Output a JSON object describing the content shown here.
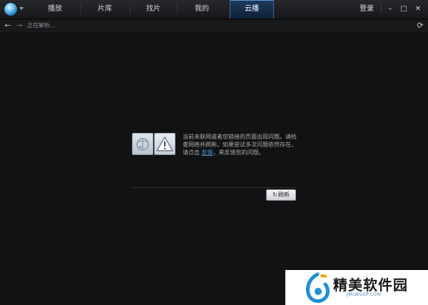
{
  "titlebar": {
    "tabs": [
      "播放",
      "片库",
      "找片",
      "我的",
      "云播"
    ],
    "active_tab": "云播",
    "login": "登录",
    "minimize": "–",
    "maximize": "□",
    "close": "✕"
  },
  "navbar": {
    "back": "←",
    "forward": "→",
    "status": "正在解析...",
    "refresh": "⟳"
  },
  "error": {
    "message_part1": "当前未联网或者您链接的页面出现问题。请检查网络并刷新。如果尝试多次问题依然存在，请点击 ",
    "link_text": "反馈",
    "message_part2": "，来反馈您的问题。",
    "refresh_button": "刷新",
    "refresh_icon": "↻"
  },
  "watermark": {
    "title": "精美软件园",
    "subtitle": "JMLWGSP.COM"
  },
  "colors": {
    "background": "#111213",
    "active_tab": "#1d3b5e",
    "link": "#4d9be0"
  },
  "icons": [
    "logo-icon",
    "dropdown-arrow-icon",
    "back-icon",
    "forward-icon",
    "reload-icon",
    "globe-error-icon",
    "warning-icon",
    "refresh-icon"
  ]
}
